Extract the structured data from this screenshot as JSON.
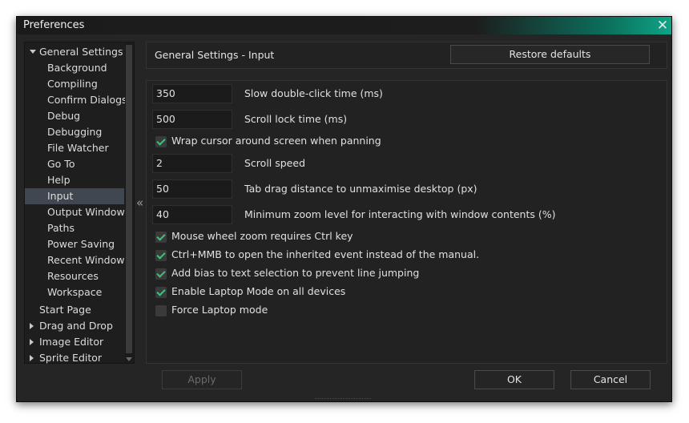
{
  "window": {
    "title": "Preferences"
  },
  "sidebar": {
    "items": [
      {
        "label": "General Settings"
      },
      {
        "label": "Background"
      },
      {
        "label": "Compiling"
      },
      {
        "label": "Confirm Dialogs"
      },
      {
        "label": "Debug"
      },
      {
        "label": "Debugging"
      },
      {
        "label": "File Watcher"
      },
      {
        "label": "Go To"
      },
      {
        "label": "Help"
      },
      {
        "label": "Input"
      },
      {
        "label": "Output Windows"
      },
      {
        "label": "Paths"
      },
      {
        "label": "Power Saving"
      },
      {
        "label": "Recent Windows"
      },
      {
        "label": "Resources"
      },
      {
        "label": "Workspace"
      },
      {
        "label": "Start Page"
      },
      {
        "label": "Drag and Drop"
      },
      {
        "label": "Image Editor"
      },
      {
        "label": "Sprite Editor"
      }
    ],
    "selected": "Input",
    "collapse_icon": "double-chevron-left"
  },
  "header": {
    "title": "General Settings - Input",
    "restore_label": "Restore defaults"
  },
  "settings": {
    "double_click_time": {
      "value": "350",
      "label": "Slow double-click time (ms)"
    },
    "scroll_lock_time": {
      "value": "500",
      "label": "Scroll lock time (ms)"
    },
    "wrap_cursor": {
      "checked": true,
      "label": "Wrap cursor around screen when panning"
    },
    "scroll_speed": {
      "value": "2",
      "label": "Scroll speed"
    },
    "tab_drag_distance": {
      "value": "50",
      "label": "Tab drag distance to unmaximise desktop (px)"
    },
    "min_zoom": {
      "value": "40",
      "label": "Minimum zoom level for interacting with window contents (%)"
    },
    "wheel_zoom_ctrl": {
      "checked": true,
      "label": "Mouse wheel zoom requires Ctrl key"
    },
    "ctrl_mmb": {
      "checked": true,
      "label": "Ctrl+MMB to open the inherited event instead of the manual."
    },
    "text_bias": {
      "checked": true,
      "label": "Add bias to text selection to prevent line jumping"
    },
    "laptop_mode_all": {
      "checked": true,
      "label": "Enable Laptop Mode on all devices"
    },
    "force_laptop": {
      "checked": false,
      "label": "Force Laptop mode"
    }
  },
  "footer": {
    "apply": "Apply",
    "ok": "OK",
    "cancel": "Cancel"
  },
  "colors": {
    "accent": "#0fa386",
    "check": "#40c27d",
    "selection": "#414751",
    "background": "#252525"
  }
}
